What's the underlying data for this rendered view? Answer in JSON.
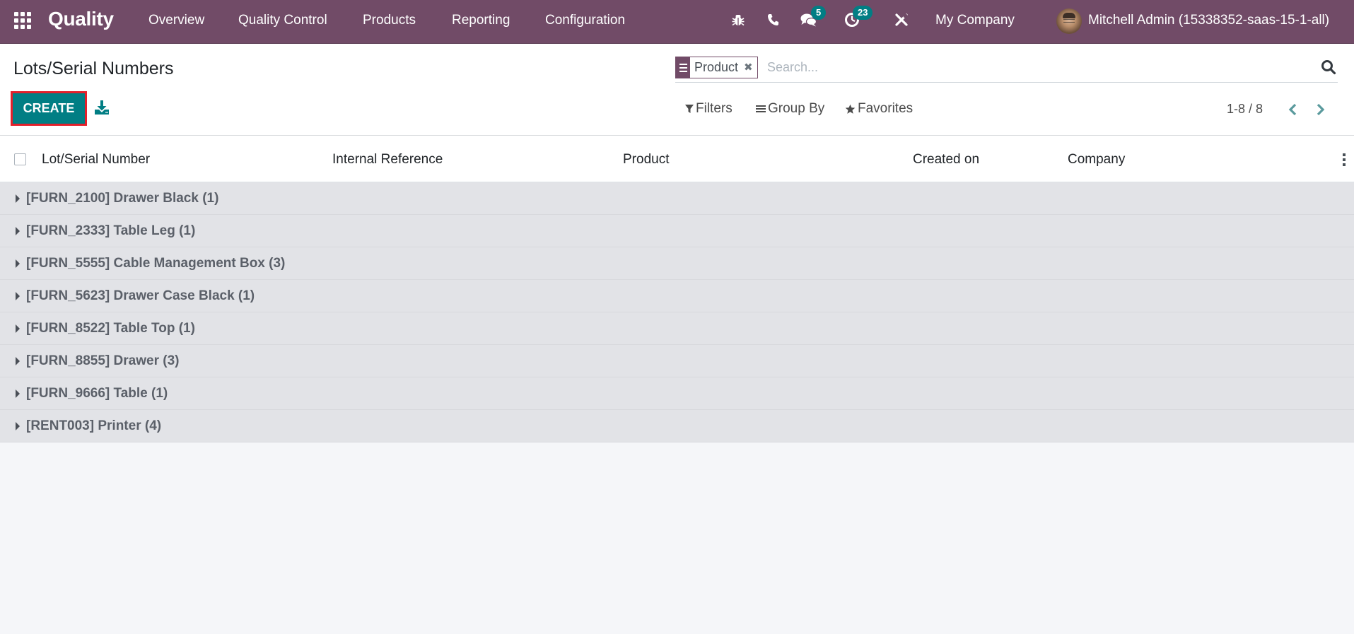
{
  "navbar": {
    "app_name": "Quality",
    "menu": [
      "Overview",
      "Quality Control",
      "Products",
      "Reporting",
      "Configuration"
    ],
    "icons": {
      "apps": "apps-grid-icon",
      "debug": "bug-icon",
      "phone": "phone-icon",
      "messages": "comments-icon",
      "activities": "clock-icon",
      "settings": "tools-icon"
    },
    "messages_badge": "5",
    "activities_badge": "23",
    "company": "My Company",
    "user": "Mitchell Admin (15338352-saas-15-1-all)"
  },
  "control_panel": {
    "title": "Lots/Serial Numbers",
    "create_label": "CREATE",
    "download_icon": "download-icon",
    "search": {
      "facet_value": "Product",
      "facet_icon": "group-by-icon",
      "placeholder": "Search..."
    },
    "filters_label": "Filters",
    "group_by_label": "Group By",
    "favorites_label": "Favorites",
    "pager": "1-8 / 8"
  },
  "list": {
    "columns": [
      "Lot/Serial Number",
      "Internal Reference",
      "Product",
      "Created on",
      "Company"
    ],
    "groups": [
      "[FURN_2100] Drawer Black (1)",
      "[FURN_2333] Table Leg (1)",
      "[FURN_5555] Cable Management Box (3)",
      "[FURN_5623] Drawer Case Black (1)",
      "[FURN_8522] Table Top (1)",
      "[FURN_8855] Drawer (3)",
      "[FURN_9666] Table (1)",
      "[RENT003] Printer (4)"
    ]
  },
  "colors": {
    "brand": "#714b67",
    "accent": "#017e84",
    "highlight_outline": "#e3202b"
  }
}
